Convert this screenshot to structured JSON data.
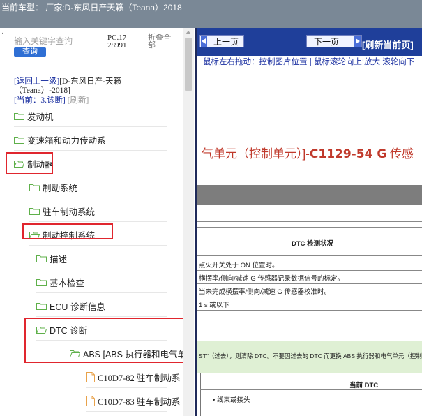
{
  "header": {
    "title": "当前车型：  厂家:D-东风日产天籁（Teana）2018"
  },
  "left_panel": {
    "search": {
      "placeholder": "输入关键字查询",
      "button": "查询"
    },
    "pc_code": "PC.17-28991",
    "collapse_all": "折叠全部",
    "back_link": "[返回上一级]",
    "back_suffix": "[D-东风日产-天籁（Teana）-2018]",
    "current_label": "[当前：3.诊断]",
    "refresh_label": "[刷新]",
    "tree": [
      {
        "label": "发动机",
        "icon": "folder-icon"
      },
      {
        "label": "变速箱和动力传动系",
        "icon": "folder-icon"
      },
      {
        "label": "制动器",
        "icon": "folder-open-icon"
      },
      {
        "label": "制动系统",
        "icon": "folder-icon"
      },
      {
        "label": "驻车制动系统",
        "icon": "folder-icon"
      },
      {
        "label": "制动控制系统",
        "icon": "folder-open-icon"
      },
      {
        "label": "描述",
        "icon": "folder-icon"
      },
      {
        "label": "基本检查",
        "icon": "folder-icon"
      },
      {
        "label": "ECU 诊断信息",
        "icon": "folder-icon"
      },
      {
        "label": "DTC 诊断",
        "icon": "folder-open-icon"
      },
      {
        "label": "ABS [ABS 执行器和电气单",
        "icon": "folder-open-icon"
      },
      {
        "label": "C10D7-82 驻车制动系",
        "icon": "document-icon"
      },
      {
        "label": "C10D7-83 驻车制动系",
        "icon": "document-icon"
      }
    ]
  },
  "right_panel": {
    "prev_button": "上一页",
    "next_button": "下一页",
    "refresh_page": "[刷新当前页]",
    "hint": "鼠标左右拖动：控制图片位置 | 鼠标滚轮向上:放大   滚轮向下",
    "doc": {
      "title_prefix": "气单元（控制单元）]-",
      "title_code": "C1129-54 G",
      "title_suffix": " 传感",
      "dtc_condition": "DTC 检测状况",
      "row1": "点火开关处于 ON 位置时。",
      "row2": "横摆率/侧向/减速 G 传感器记录数据信号的标定。",
      "row3": "当未完成横摆率/侧向/减速 G 传感器校准时。",
      "row4": "1 s 或以下",
      "green_note": "ST\"（过去），则清除 DTC。不要因过去的 DTC 而更换 ABS 执行器和电气单元（控制单",
      "current_dtc": "当前 DTC",
      "bullet": "• 线束或接头"
    }
  },
  "colors": {
    "header_bg": "#7a8896",
    "toolbar_bg": "#1f3f9a",
    "highlight": "#e0262e",
    "doc_title": "#c0392b",
    "link": "#1a2fa0"
  }
}
